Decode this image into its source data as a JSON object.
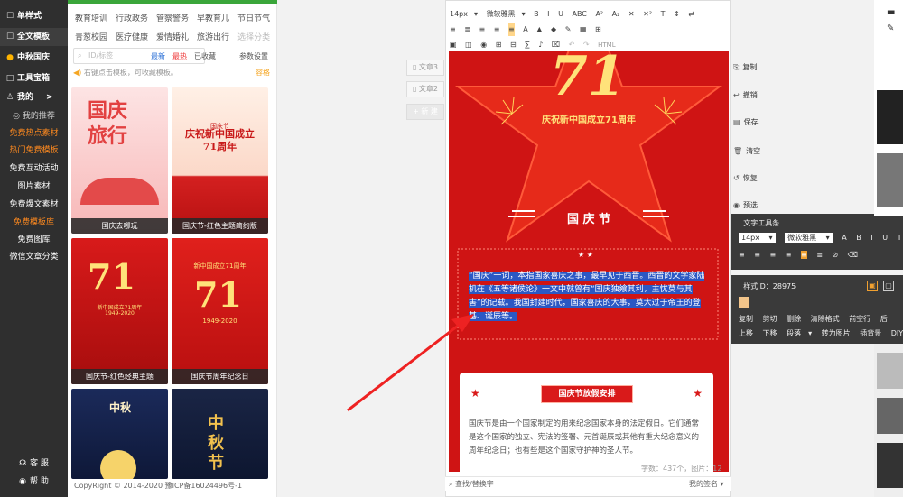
{
  "sidebar": {
    "items": [
      {
        "icon": "☐",
        "label": "单样式"
      },
      {
        "icon": "☐",
        "label": "全文模板"
      },
      {
        "icon": "●",
        "label": "中秋国庆"
      },
      {
        "icon": "□",
        "label": "工具宝箱"
      },
      {
        "icon": "♙",
        "label": "我的"
      }
    ],
    "my_arrow": ">",
    "sub_items": [
      {
        "label": "我的推荐"
      },
      {
        "label": "免费热点素材"
      },
      {
        "label": "热门免费模板"
      },
      {
        "label": "免费互动活动"
      },
      {
        "label": "图片素材"
      },
      {
        "label": "免费爆文素材"
      },
      {
        "label": "免费模板库"
      },
      {
        "label": "免费图库"
      },
      {
        "label": "微信文章分类"
      }
    ],
    "service_label": "客 服",
    "help_label": "帮 助"
  },
  "categories": {
    "row1": [
      "教育培训",
      "行政政务",
      "管察警务",
      "早教育儿",
      "节日节气"
    ],
    "row2": [
      "青葱校园",
      "医疗健康",
      "爱情婚礼",
      "旅游出行",
      "选择分类"
    ],
    "search_placeholder": "ID/标签",
    "tabs": [
      "最新",
      "最热",
      "已收藏",
      "参数设置"
    ],
    "tip": "右键点击模板，可收藏模板。",
    "tip_link": "容格",
    "cards": [
      {
        "caption": "国庆去哪玩",
        "big": "国庆\n旅行"
      },
      {
        "caption": "国庆节-红色主题简约版",
        "big": "庆祝新中国成立\n71周年"
      },
      {
        "caption": "国庆节-红色经典主题",
        "big": "71"
      },
      {
        "caption": "国庆节周年纪念日",
        "big": "71"
      },
      {
        "caption": "",
        "big": "中秋"
      },
      {
        "caption": "",
        "big": "中\n秋\n节"
      }
    ],
    "card_sub": [
      "国庆节",
      "新中国成立71周年",
      "1949-2020"
    ],
    "copyright": "CopyRight © 2014-2020 豫ICP备16024496号-1"
  },
  "docs": {
    "doc3": "文章3",
    "doc2": "文章2",
    "new": "+ 新 建"
  },
  "editor": {
    "font_size": "14px",
    "font_family": "微软雅黑",
    "toolbar_row1": [
      "B",
      "I",
      "U",
      "ABC",
      "A²",
      "A₂",
      "✕",
      "✕²",
      "T",
      "↕",
      "⇄"
    ],
    "toolbar_row2": [
      "≡",
      "≣",
      "≡",
      "≡",
      "≡",
      "A",
      "▲",
      "◆",
      "✎",
      "▦",
      "⊞"
    ],
    "toolbar_row3": [
      "▣",
      "◫",
      "◉",
      "⊞",
      "⊟",
      "∑",
      "♪",
      "⌧",
      "↶",
      "↷",
      "HTML"
    ],
    "poster": {
      "big": "71",
      "headline": "庆祝新中国成立71周年",
      "festival": "国 庆 节",
      "paragraph": "“国庆”一词，本指国家喜庆之事，最早见于西晋。西晋的文学家陆机在《五等诸侯论》一文中就曾有“国庆独飨其利，主忧莫与其害”的记载。我国封建时代，国家喜庆的大事，莫大过于帝王的登基、诞辰等。",
      "card_title": "国庆节放假安排",
      "card_text": "国庆节是由一个国家制定的用来纪念国家本身的法定假日。它们通常是这个国家的独立、宪法的签署、元首诞辰或其他有重大纪念意义的周年纪念日；也有些是这个国家守护神的圣人节。"
    },
    "status": "字数：437个，图片：12",
    "bottom_left": "查找/替换字",
    "bottom_right": "我的签名"
  },
  "right_tools": [
    {
      "icon": "⎘",
      "label": "复制"
    },
    {
      "icon": "↩",
      "label": "撤销"
    },
    {
      "icon": "▤",
      "label": "保存"
    },
    {
      "icon": "🗑",
      "label": "清空"
    },
    {
      "icon": "↺",
      "label": "恢复"
    },
    {
      "icon": "◉",
      "label": "预选"
    }
  ],
  "text_toolbar": {
    "title": "文字工具条",
    "size": "14px",
    "font": "微软雅黑",
    "row1": [
      "A",
      "B",
      "I",
      "U",
      "T"
    ],
    "row2": [
      "≡",
      "≡",
      "≡",
      "≡",
      "≡",
      "≣",
      "⊘",
      "⌫"
    ]
  },
  "style_toolbar": {
    "title": "样式ID：28975",
    "row1": [
      "复制",
      "剪切",
      "删除",
      "清除格式",
      "前空行",
      "后"
    ],
    "row2": [
      "上移",
      "下移",
      "段落",
      "转为图片",
      "插背景",
      "DIY"
    ]
  },
  "colors": {
    "accent": "#ff8a1f",
    "poster_red": "#cf1414",
    "gold": "#ffe27a",
    "sidebar": "#2f2f2f"
  }
}
